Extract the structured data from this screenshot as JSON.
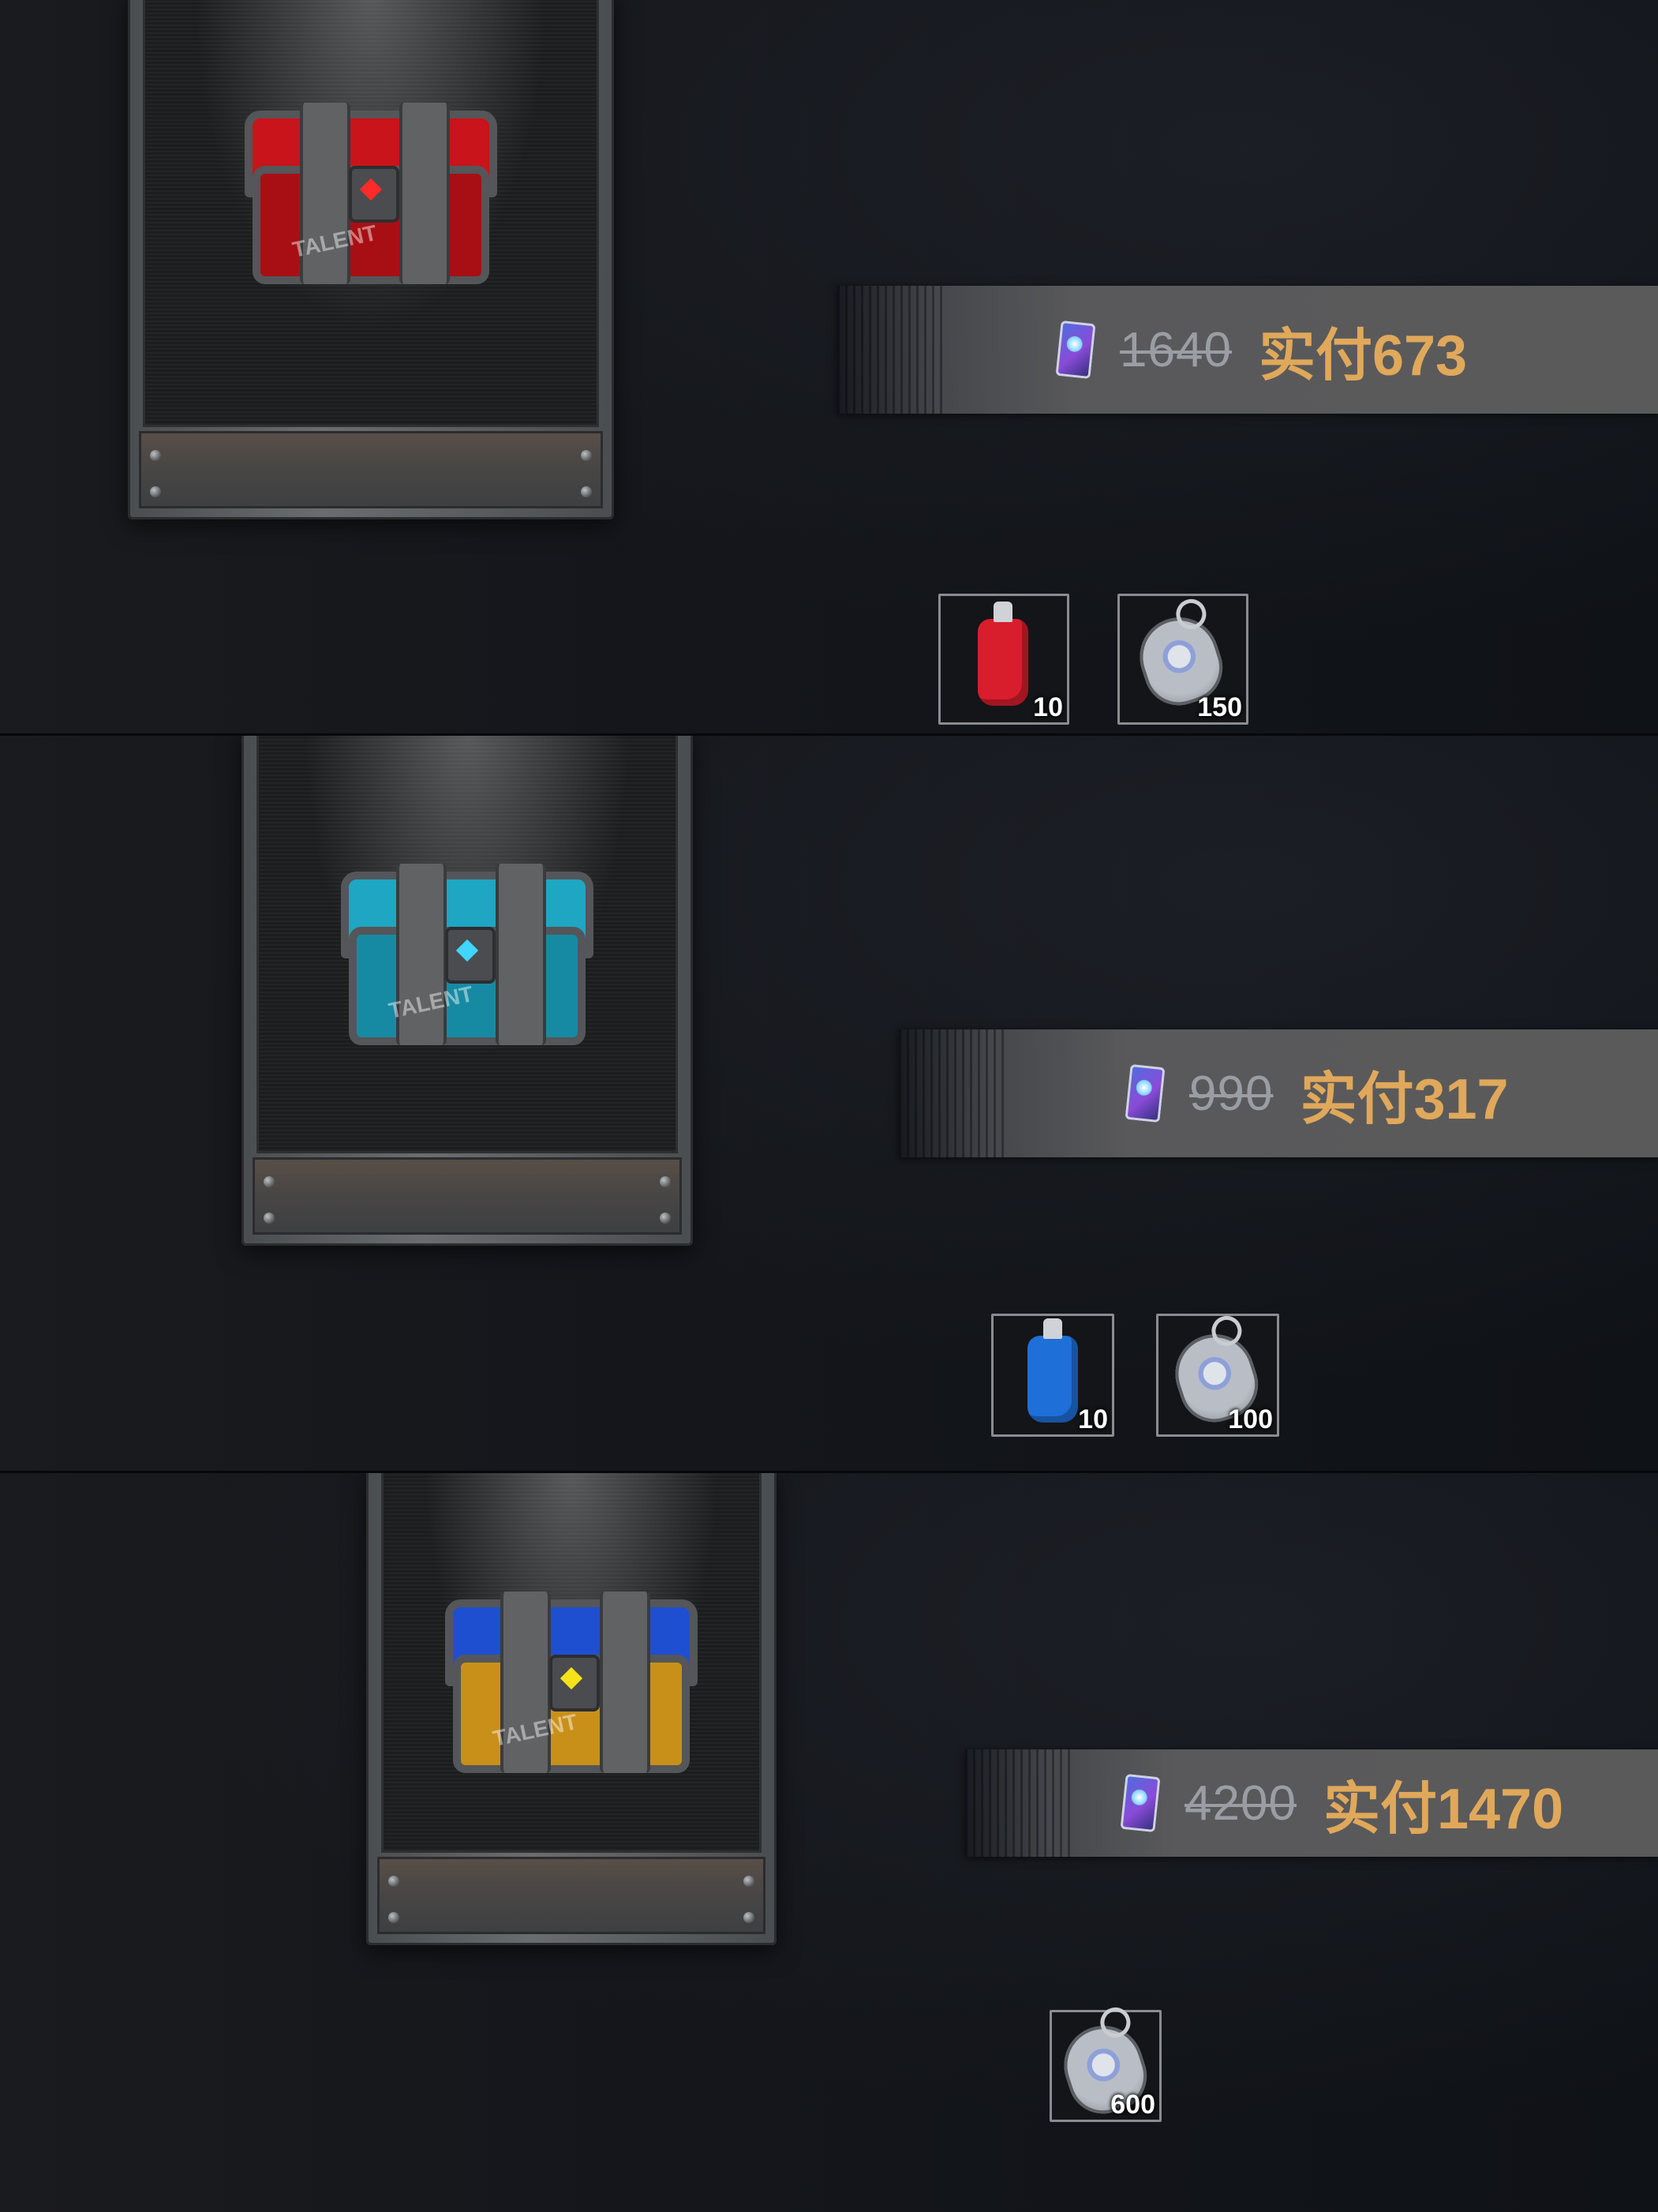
{
  "colors": {
    "price_highlight": "#e0a85a",
    "price_old": "#9a9ea4",
    "price_bar": "#5a5a5b"
  },
  "chest_label": "TALENT",
  "offers": [
    {
      "chest_color": "red",
      "chest_hex": "#c8141a",
      "old_price": "1640",
      "final_price": "实付673",
      "rewards": [
        {
          "icon": "red-spray-bottle-icon",
          "quantity": "10"
        },
        {
          "icon": "dog-tag-icon",
          "quantity": "150"
        }
      ]
    },
    {
      "chest_color": "cyan",
      "chest_hex": "#1ea6c3",
      "old_price": "990",
      "final_price": "实付317",
      "rewards": [
        {
          "icon": "blue-spray-bottle-icon",
          "quantity": "10"
        },
        {
          "icon": "dog-tag-icon",
          "quantity": "100"
        }
      ]
    },
    {
      "chest_color": "blue-yellow",
      "chest_hex": "#1f4fd1",
      "old_price": "4200",
      "final_price": "实付1470",
      "rewards": [
        {
          "icon": "dog-tag-icon",
          "quantity": "600"
        }
      ]
    }
  ]
}
